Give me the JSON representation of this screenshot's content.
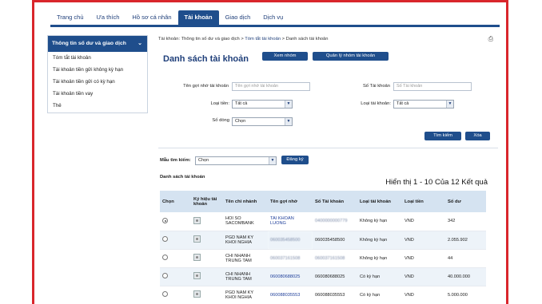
{
  "topnav": {
    "tabs": [
      "Trang chủ",
      "Ưa thích",
      "Hồ sơ cá nhân",
      "Tài khoản",
      "Giao dịch",
      "Dịch vụ"
    ],
    "active_index": 3
  },
  "sidebar": {
    "header": "Thông tin số dư và giao dịch",
    "items": [
      "Tóm tắt tài khoản",
      "Tài khoản tiền gửi không kỳ hạn",
      "Tài khoản tiền gửi có kỳ hạn",
      "Tài khoản tiền vay",
      "Thẻ"
    ]
  },
  "breadcrumb": {
    "prefix": "Tài khoản: Thông tin số dư và giao dịch > ",
    "link": "Tóm tắt tài khoản",
    "suffix": " > Danh sách tài khoản"
  },
  "page": {
    "title": "Danh sách tài khoản",
    "view_group_button": "Xem nhóm",
    "manage_group_button": "Quản lý nhóm tài khoản"
  },
  "search": {
    "nickname_label": "Tên gợi nhớ tài khoản",
    "nickname_placeholder": "Tên gợi nhớ tài khoản",
    "account_no_label": "Số Tài khoản",
    "account_no_placeholder": "Số Tài khoản",
    "currency_label": "Loại tiền:",
    "currency_value": "Tất cả",
    "account_type_label": "Loại tài khoản:",
    "account_type_value": "Tất cả",
    "rows_label": "Số dòng",
    "rows_value": "Chọn",
    "search_button": "Tìm kiếm",
    "clear_button": "Xóa"
  },
  "template": {
    "label": "Mẫu tìm kiếm:",
    "value": "Chọn",
    "register_button": "Đăng ký"
  },
  "list": {
    "title": "Danh sách tài khoản",
    "summary": "Hiển thị 1 - 10 Của 12 Kết quả",
    "columns": [
      "Chọn",
      "Ký hiệu tài khoản",
      "Tên chi nhánh",
      "Tên gợi nhớ",
      "Số Tài khoản",
      "Loại tài khoản",
      "Loại tiền",
      "Số dư"
    ],
    "rows": [
      {
        "branch": "HOI SO SACOMBANK",
        "nickname": "TAI KHOAN LUONG",
        "account_no": "0400000000779",
        "type": "Không kỳ hạn",
        "currency": "VND",
        "balance": "342"
      },
      {
        "branch": "PGD NAM KY KHOI NGHIA",
        "nickname": "060035458500",
        "account_no": "060035458500",
        "type": "Không kỳ hạn",
        "currency": "VND",
        "balance": "2.055.902"
      },
      {
        "branch": "CHI NHANH TRUNG TAM",
        "nickname": "060037161508",
        "account_no": "060037161508",
        "type": "Không kỳ hạn",
        "currency": "VND",
        "balance": "44"
      },
      {
        "branch": "CHI NHANH TRUNG TAM",
        "nickname": "060080688025",
        "account_no": "060080688025",
        "type": "Có kỳ hạn",
        "currency": "VND",
        "balance": "40.000.000"
      },
      {
        "branch": "PGD NAM KY KHOI NGHIA",
        "nickname": "060088035553",
        "account_no": "060088035553",
        "type": "Có kỳ hạn",
        "currency": "VND",
        "balance": "5.000.000"
      }
    ]
  },
  "colors": {
    "brand_blue": "#1f4e8c",
    "frame_red": "#d9262c",
    "header_row": "#d5e3f1"
  }
}
